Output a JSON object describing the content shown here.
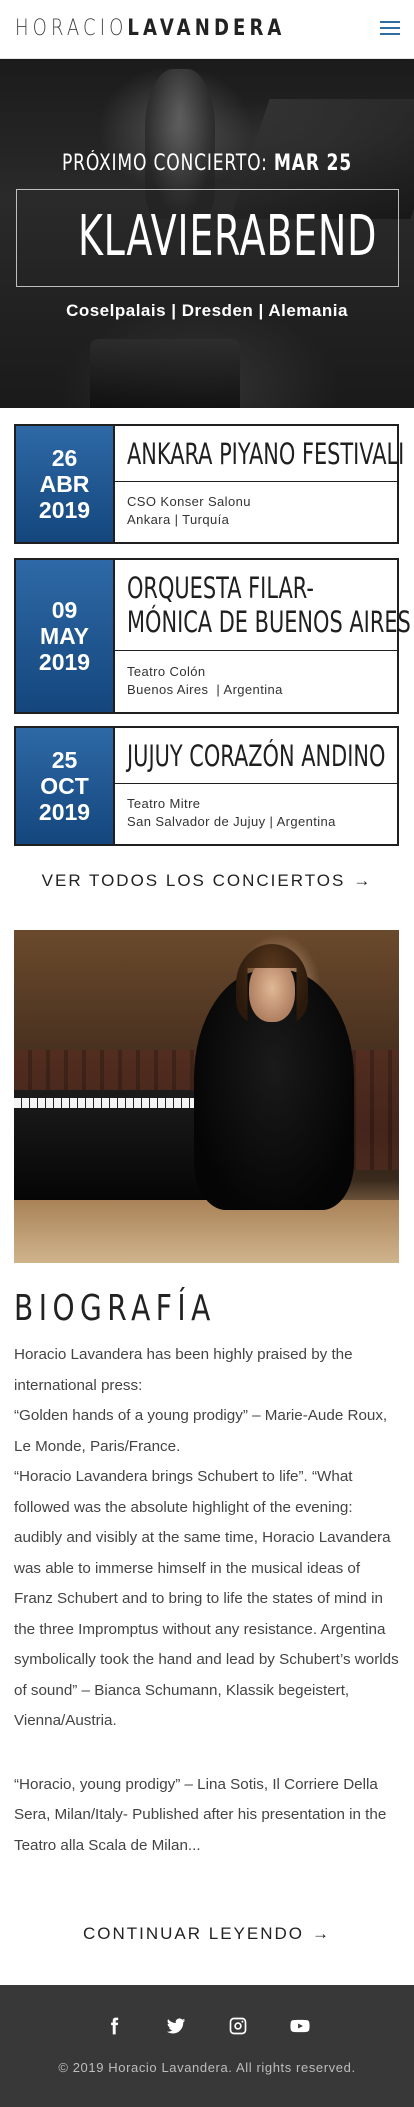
{
  "header": {
    "logo_first": "HORACIO",
    "logo_last": "LAVANDERA",
    "menu_icon": "hamburger-menu-icon"
  },
  "hero": {
    "next_label": "PRÓXIMO CONCIERTO:",
    "next_date": "MAR 25",
    "title": "KLAVIERABEND",
    "venue": "Coselpalais | Dresden | Alemania"
  },
  "concerts": [
    {
      "day": "26",
      "month": "ABR",
      "year": "2019",
      "title_lines": [
        "ANKARA PIYANO FESTIVALI"
      ],
      "venue": "CSO Konser Salonu",
      "location": "Ankara | Turquía"
    },
    {
      "day": "09",
      "month": "MAY",
      "year": "2019",
      "title_lines": [
        "ORQUESTA FILAR-",
        "MÓNICA DE BUENOS AIRES"
      ],
      "venue": "Teatro Colón",
      "location": "Buenos Aires  | Argentina"
    },
    {
      "day": "25",
      "month": "OCT",
      "year": "2019",
      "title_lines": [
        "JUJUY CORAZÓN ANDINO"
      ],
      "venue": "Teatro Mitre",
      "location": "San Salvador de Jujuy | Argentina"
    }
  ],
  "see_all": {
    "label": "VER TODOS LOS CONCIERTOS",
    "arrow": "→"
  },
  "bio": {
    "title": "BIOGRAFÍA",
    "paragraphs": [
      "Horacio Lavandera has been highly praised by the international press:",
      "“Golden hands of a young prodigy” – Marie-Aude Roux, Le Monde, Paris/France.",
      "“Horacio Lavandera brings Schubert to life”. “What followed was the absolute highlight of the evening: audibly and visibly at the same time, Horacio Lavandera was able to immerse himself in the musical ideas of Franz Schubert and to bring to life the states of mind in the three Impromptus without any resistance. Argentina symbolically took the hand and lead by Schubert’s worlds of sound” – Bianca Schumann, Klassik begeistert, Vienna/Austria.",
      "“Horacio, young prodigy” – Lina Sotis, Il Corriere Della Sera, Milan/Italy- Published after his presentation in the Teatro alla Scala de Milan..."
    ],
    "read_more": "CONTINUAR LEYENDO",
    "read_more_arrow": "→"
  },
  "footer": {
    "socials": [
      "facebook-icon",
      "twitter-icon",
      "instagram-icon",
      "youtube-icon"
    ],
    "copyright": "© 2019 Horacio Lavandera. All rights reserved."
  },
  "colors": {
    "accent": "#2f6ea3",
    "date_box_top": "#2e69a6",
    "date_box_bottom": "#14467d",
    "footer_bg": "#383838"
  }
}
